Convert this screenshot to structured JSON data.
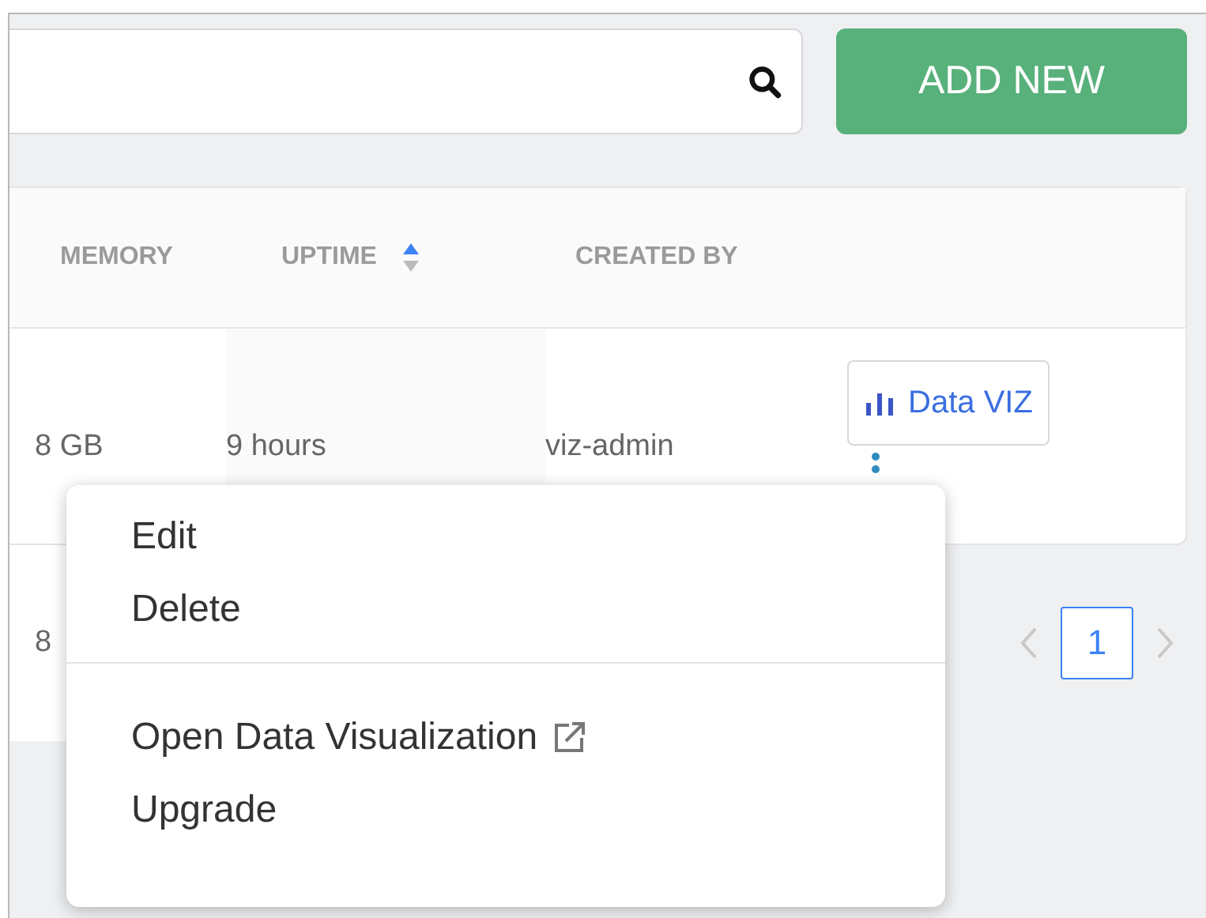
{
  "add_button": "ADD NEW",
  "table": {
    "columns": [
      {
        "label": "MEMORY",
        "sorted": false
      },
      {
        "label": "UPTIME",
        "sorted": true
      },
      {
        "label": "CREATED BY",
        "sorted": false
      }
    ],
    "rows": [
      {
        "cells": [
          "8 GB",
          "9 hours",
          "viz-admin"
        ],
        "tag": "Data VIZ"
      },
      {
        "cells": [
          "8"
        ]
      }
    ]
  },
  "pagination": {
    "pages": [
      {
        "label": "1",
        "selected": true
      }
    ]
  },
  "menu": {
    "groups": [
      [
        {
          "label": "Edit",
          "external": false
        },
        {
          "label": "Delete",
          "external": false
        }
      ],
      [
        {
          "label": "Open Data Visualization",
          "external": true
        },
        {
          "label": "Upgrade",
          "external": false
        }
      ]
    ]
  }
}
